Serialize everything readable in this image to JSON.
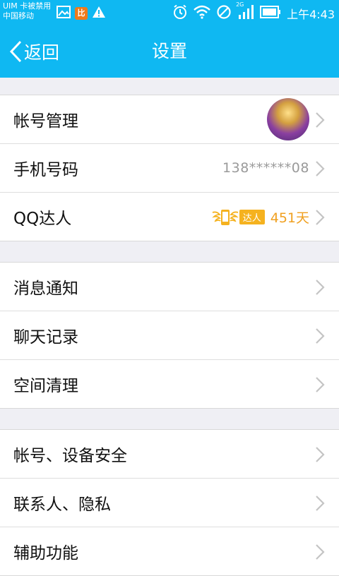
{
  "status_bar": {
    "carrier_line1": "UIM 卡被禁用",
    "carrier_line2": "中国移动",
    "badge_text": "比",
    "network": "2G",
    "time": "上午4:43"
  },
  "header": {
    "back_label": "返回",
    "title": "设置"
  },
  "groups": [
    {
      "rows": [
        {
          "label": "帐号管理"
        },
        {
          "label": "手机号码",
          "value": "138******08"
        },
        {
          "label": "QQ达人",
          "badge_text": "达人",
          "days": "451天"
        }
      ]
    },
    {
      "rows": [
        {
          "label": "消息通知"
        },
        {
          "label": "聊天记录"
        },
        {
          "label": "空间清理"
        }
      ]
    },
    {
      "rows": [
        {
          "label": "帐号、设备安全"
        },
        {
          "label": "联系人、隐私"
        },
        {
          "label": "辅助功能"
        }
      ]
    }
  ],
  "colors": {
    "brand": "#0fb8f2",
    "accent_orange": "#f0a020"
  },
  "icons": [
    "image-icon",
    "app-badge-icon",
    "warning-icon",
    "alarm-icon",
    "wifi-icon",
    "blocked-icon",
    "signal-icon",
    "battery-icon",
    "chevron-right-icon"
  ]
}
